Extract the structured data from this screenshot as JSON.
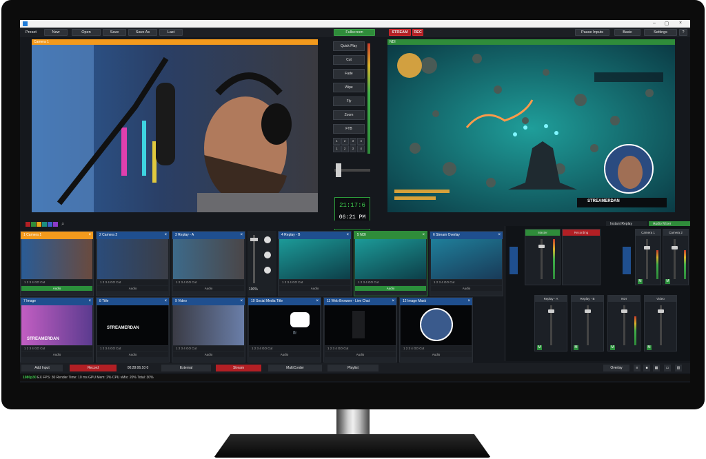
{
  "menu": {
    "preset": "Preset",
    "new": "New",
    "open": "Open",
    "save": "Save",
    "save_as": "Save As",
    "last": "Last",
    "fullscreen": "Fullscreen",
    "stream": "STREAM",
    "rec": "REC",
    "pause_inputs": "Pause Inputs",
    "basic": "Basic",
    "settings": "Settings",
    "help": "?"
  },
  "window": {
    "minimize": "–",
    "maximize": "▢",
    "close": "×"
  },
  "preview": {
    "title": "Camera 1"
  },
  "output": {
    "title": "NDI"
  },
  "transitions": {
    "quick_play": "Quick Play",
    "cut": "Cut",
    "fade": "Fade",
    "wipe": "Wipe",
    "fly": "Fly",
    "zoom": "Zoom",
    "ftb": "FTB",
    "numbers": [
      "1",
      "2",
      "3",
      "4",
      "1",
      "2",
      "3",
      "4"
    ]
  },
  "clock": {
    "time1": "21:17:6",
    "time2": "06:21 PM"
  },
  "output_overlay": {
    "brand": "STREAMERDAN"
  },
  "colors": {
    "accent_orange": "#f39a1d",
    "accent_blue": "#1f4f8f",
    "accent_green": "#2f8c3a",
    "rec_red": "#b21f24"
  },
  "tabs_right": {
    "instant_replay": "Instant Replay",
    "audio_mixer": "Audio Mixer"
  },
  "inputs_row1": [
    {
      "num": "1",
      "title": "Camera 1",
      "audio": "Audio",
      "audio_on": true,
      "color": "#f39a1d"
    },
    {
      "num": "2",
      "title": "Camera 2",
      "audio": "Audio",
      "audio_on": false,
      "color": "#1f4f8f"
    },
    {
      "num": "3",
      "title": "Replay - A",
      "audio": "Audio",
      "audio_on": false,
      "color": "#1f4f8f"
    },
    {
      "num": "4",
      "title": "Replay - B",
      "audio": "Audio",
      "audio_on": false,
      "color": "#1f4f8f"
    },
    {
      "num": "5",
      "title": "NDI",
      "audio": "Audio",
      "audio_on": true,
      "color": "#2f8c3a"
    },
    {
      "num": "6",
      "title": "Stream Overlay",
      "audio": "Audio",
      "audio_on": false,
      "color": "#1f4f8f"
    }
  ],
  "inputs_row2": [
    {
      "num": "7",
      "title": "Image",
      "audio": "Audio",
      "color": "#1f4f8f"
    },
    {
      "num": "8",
      "title": "Title",
      "audio": "Audio",
      "color": "#1f4f8f"
    },
    {
      "num": "9",
      "title": "Video",
      "audio": "Audio",
      "color": "#1f4f8f"
    },
    {
      "num": "10",
      "title": "Social Media Title",
      "audio": "Audio",
      "color": "#1f4f8f"
    },
    {
      "num": "11",
      "title": "Web Browser - Live Chat",
      "audio": "Audio",
      "color": "#1f4f8f"
    },
    {
      "num": "12",
      "title": "Image Mask",
      "audio": "Audio",
      "color": "#1f4f8f"
    }
  ],
  "tile_controls": "1 2 3 4   GO  Cut",
  "tile_brand": "STREAMERDAN",
  "social_text": "ffr",
  "mixer": {
    "master": "Master",
    "recording": "Recording",
    "channels_top": [
      "Camera 1",
      "Camera 2"
    ],
    "channels_bottom": [
      "Replay - A",
      "Replay - B",
      "NDI",
      "Video"
    ],
    "mute": "M",
    "side_a": "A",
    "side_b": "B"
  },
  "bottom": {
    "add_input": "Add Input",
    "record": "Record",
    "record_time": "00:28:06.10 0",
    "external": "External",
    "stream": "Stream",
    "multicorder": "MultiCorder",
    "playlist": "Playlist",
    "overlay": "Overlay"
  },
  "status": {
    "res": "1080p30",
    "ex": "EX",
    "fps_label": "FPS:",
    "fps": "30",
    "render_label": "Render Time:",
    "render": "10 ms",
    "gpu_label": "GPU Mem:",
    "gpu": "2%",
    "cpu_label": "CPU vMix:",
    "cpu": "20%",
    "total_label": "Total:",
    "total": "30%"
  },
  "zoom_label": "100%"
}
